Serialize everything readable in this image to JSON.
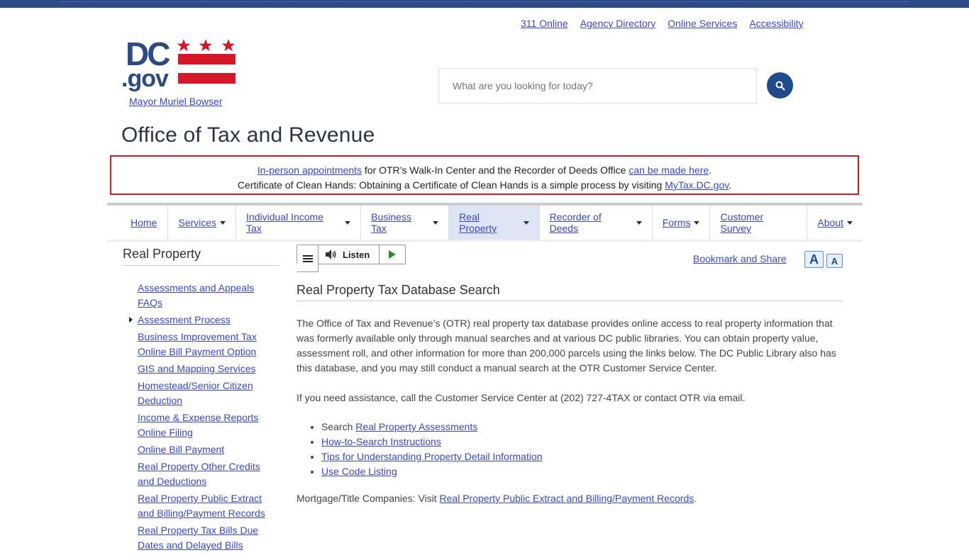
{
  "utility_nav": [
    "311 Online",
    "Agency Directory",
    "Online Services",
    "Accessibility"
  ],
  "logo": {
    "text": "DC.gov"
  },
  "mayor_link": "Mayor Muriel Bowser",
  "search": {
    "placeholder": "What are you looking for today?"
  },
  "agency_title": "Office of Tax and Revenue",
  "alert": {
    "line1_link1": "In-person appointments",
    "line1_text": " for OTR’s Walk-In Center and the Recorder of Deeds Office ",
    "line1_link2": "can be made here",
    "line1_end": ".",
    "line2_text": "Certificate of Clean Hands: Obtaining a Certificate of Clean Hands is a simple process by visiting ",
    "line2_link": "MyTax.DC.gov",
    "line2_end": "."
  },
  "main_nav": [
    {
      "label": "Home",
      "dropdown": false
    },
    {
      "label": "Services",
      "dropdown": true
    },
    {
      "label": "Individual Income Tax",
      "dropdown": true
    },
    {
      "label": "Business Tax",
      "dropdown": true
    },
    {
      "label": "Real Property",
      "dropdown": true,
      "active": true
    },
    {
      "label": "Recorder of Deeds",
      "dropdown": true
    },
    {
      "label": "Forms",
      "dropdown": true
    },
    {
      "label": "Customer Survey",
      "dropdown": false
    },
    {
      "label": "About",
      "dropdown": true
    }
  ],
  "sidebar": {
    "title": "Real Property",
    "items": [
      "Assessments and Appeals FAQs",
      "Assessment Process",
      "Business Improvement Tax Online Bill Payment Option",
      "GIS and Mapping Services",
      "Homestead/Senior Citizen Deduction",
      "Income & Expense Reports Online Filing",
      "Online Bill Payment",
      "Real Property Other Credits and Deductions",
      "Real Property Public Extract and Billing/Payment Records",
      "Real Property Tax Bills Due Dates and Delayed Bills"
    ]
  },
  "toolbar": {
    "listen_label": "Listen"
  },
  "bookmark_label": "Bookmark and Share",
  "font_controls": {
    "increase": "A",
    "decrease": "A"
  },
  "content": {
    "title": "Real Property Tax Database Search",
    "para1": "The Office of Tax and Revenue’s (OTR) real property tax database provides online access to real property information that was formerly available only through manual searches and at various DC public libraries. You can obtain property value, assessment roll, and other information for more than 200,000 parcels using the links below. The DC Public Library also has this database, and you may still conduct a manual search at the OTR Customer Service Center.",
    "para2": "If you need assistance, call the Customer Service Center at (202) 727-4TAX or contact OTR via email.",
    "link_prefix": "Search ",
    "links": [
      "Real Property Assessments",
      "How-to-Search Instructions",
      "Tips for Understanding Property Detail Information",
      "Use Code Listing"
    ],
    "mortgage_text": "Mortgage/Title Companies: Visit ",
    "mortgage_link": "Real Property Public Extract and Billing/Payment Records",
    "mortgage_end": "."
  }
}
